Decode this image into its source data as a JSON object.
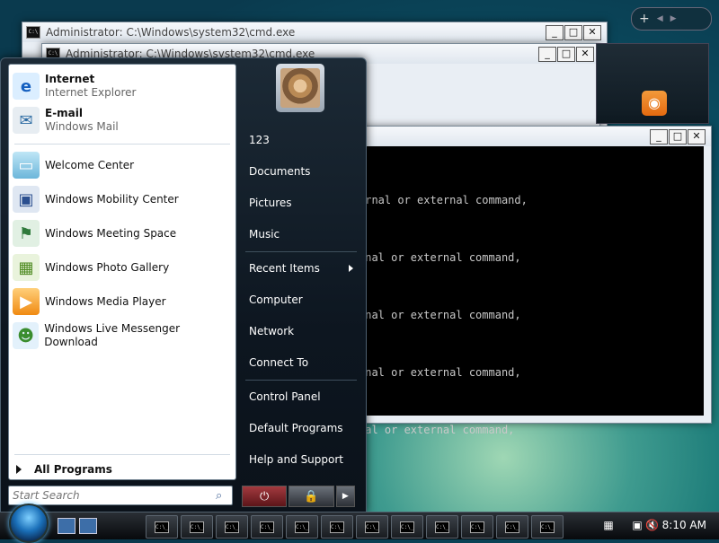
{
  "cmd_windows": [
    {
      "title": "Administrator: C:\\Windows\\system32\\cmd.exe"
    },
    {
      "title": "Administrator: C:\\Windows\\system32\\cmd.exe"
    }
  ],
  "console_lines": [
    "ernal or external command,",
    "rnal or external command,",
    "rnal or external command,",
    "rnal or external command,",
    "nal or external command,"
  ],
  "window_buttons": {
    "minimize": "_",
    "maximize": "□",
    "close": "✕"
  },
  "gadgets": {
    "add": "+",
    "prev": "◀",
    "next": "▶"
  },
  "start_menu": {
    "pinned": [
      {
        "title": "Internet",
        "subtitle": "Internet Explorer",
        "icon": "internet-explorer-icon"
      },
      {
        "title": "E-mail",
        "subtitle": "Windows Mail",
        "icon": "windows-mail-icon"
      }
    ],
    "recent": [
      {
        "label": "Welcome Center",
        "icon": "welcome-center-icon"
      },
      {
        "label": "Windows Mobility Center",
        "icon": "mobility-center-icon"
      },
      {
        "label": "Windows Meeting Space",
        "icon": "meeting-space-icon"
      },
      {
        "label": "Windows Photo Gallery",
        "icon": "photo-gallery-icon"
      },
      {
        "label": "Windows Media Player",
        "icon": "media-player-icon"
      },
      {
        "label": "Windows Live Messenger Download",
        "icon": "messenger-icon"
      }
    ],
    "all_programs": "All Programs",
    "search_placeholder": "Start Search",
    "right_items": {
      "user": "123",
      "documents": "Documents",
      "pictures": "Pictures",
      "music": "Music",
      "recent_items": "Recent Items",
      "computer": "Computer",
      "network": "Network",
      "connect_to": "Connect To",
      "control_panel": "Control Panel",
      "default_programs": "Default Programs",
      "help_support": "Help and Support"
    }
  },
  "taskbar": {
    "clock": "8:10 AM",
    "button_count": 12,
    "button_label": "C:\\_"
  },
  "colors": {
    "accent": "#1a6fb8",
    "power_red": "#7a1f24",
    "lock_gray": "#4a4f56"
  }
}
